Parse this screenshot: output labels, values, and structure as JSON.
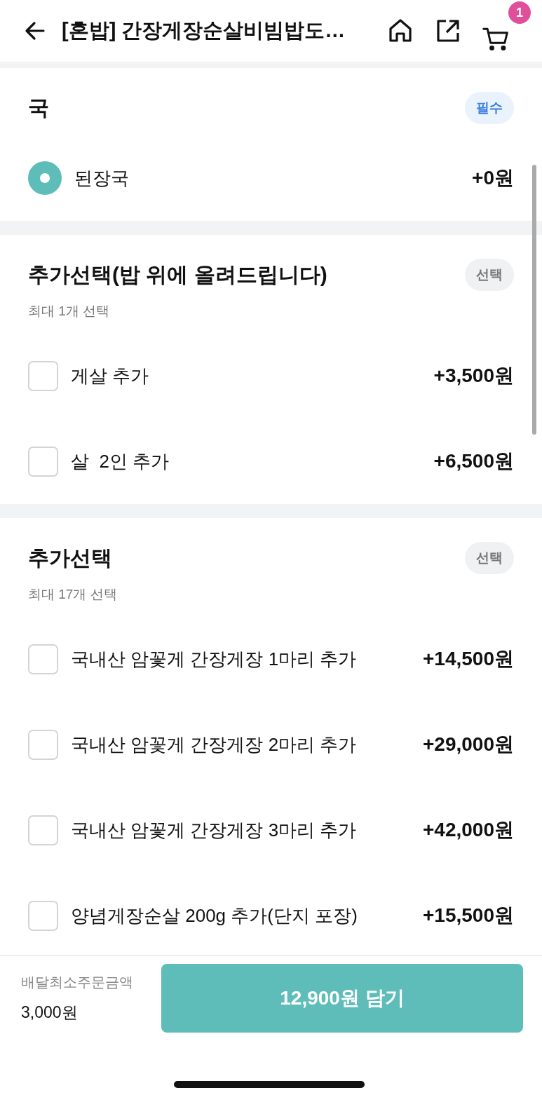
{
  "header": {
    "title": "[혼밥] 간장게장순살비빔밥도…",
    "cart_count": "1"
  },
  "sections": [
    {
      "title": "국",
      "badge": {
        "kind": "required",
        "label": "필수"
      },
      "options": [
        {
          "kind": "radio",
          "label": "된장국",
          "price": "+0원",
          "selected": true
        }
      ]
    },
    {
      "title": "추가선택(밥 위에 올려드립니다)",
      "badge": {
        "kind": "optional",
        "label": "선택"
      },
      "subtitle": "최대 1개 선택",
      "options": [
        {
          "kind": "checkbox",
          "label": "게살 추가",
          "price": "+3,500원",
          "checked": false
        },
        {
          "kind": "checkbox",
          "label": "살  2인 추가",
          "price": "+6,500원",
          "checked": false
        }
      ]
    },
    {
      "title": "추가선택",
      "badge": {
        "kind": "optional",
        "label": "선택"
      },
      "subtitle": "최대 17개 선택",
      "options": [
        {
          "kind": "checkbox",
          "label": "국내산 암꽃게 간장게장 1마리 추가",
          "price": "+14,500원",
          "checked": false
        },
        {
          "kind": "checkbox",
          "label": "국내산 암꽃게 간장게장 2마리 추가",
          "price": "+29,000원",
          "checked": false
        },
        {
          "kind": "checkbox",
          "label": "국내산 암꽃게 간장게장 3마리 추가",
          "price": "+42,000원",
          "checked": false
        },
        {
          "kind": "checkbox",
          "label": "양념게장순살 200g 추가(단지 포장)",
          "price": "+15,500원",
          "checked": false
        }
      ]
    }
  ],
  "footer": {
    "min_order_label": "배달최소주문금액",
    "min_order_value": "3,000원",
    "add_button": "12,900원 담기"
  }
}
